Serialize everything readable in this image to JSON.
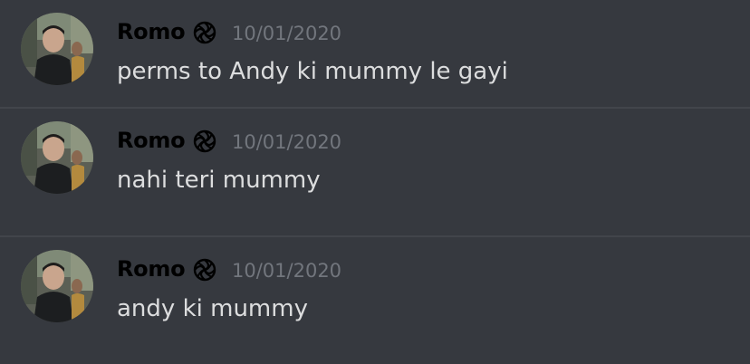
{
  "messages": [
    {
      "author": "Romo",
      "badge_icon": "spiral-badge-icon",
      "timestamp": "10/01/2020",
      "content": "perms to Andy ki mummy le gayi"
    },
    {
      "author": "Romo",
      "badge_icon": "spiral-badge-icon",
      "timestamp": "10/01/2020",
      "content": "nahi teri mummy"
    },
    {
      "author": "Romo",
      "badge_icon": "spiral-badge-icon",
      "timestamp": "10/01/2020",
      "content": "andy ki mummy"
    }
  ],
  "colors": {
    "background": "#36393f",
    "divider": "#42454b",
    "username": "#000000",
    "timestamp": "#72767d",
    "message_text": "#dcddde"
  }
}
